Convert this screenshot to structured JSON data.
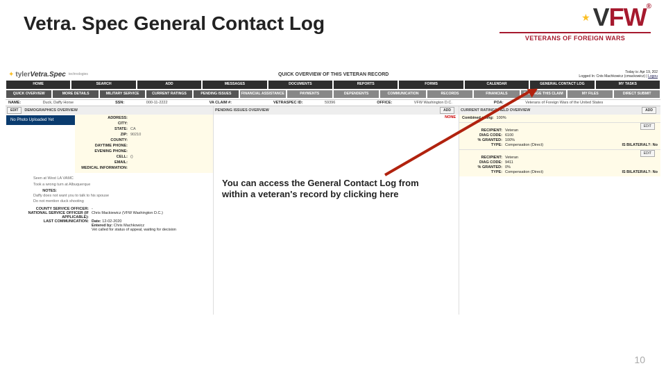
{
  "slide": {
    "title": "Vetra. Spec General Contact Log",
    "number": "10"
  },
  "vfw": {
    "sub": "VETERANS OF FOREIGN WARS",
    "reg": "®",
    "v": "V",
    "fw": "FW"
  },
  "callout": "You can access the General Contact Log from within a veteran's record by clicking here",
  "branding": {
    "t1": "tyler",
    "t2": "Vetra.Spec",
    "sub": "technologies"
  },
  "overview_title": "QUICK OVERVIEW OF THIS VETERAN RECORD",
  "login": {
    "today": "Today is: Apr 19, 202",
    "who": "Logged In: Cnts Machkowicz (cmackowicz) |",
    "logout": "Logou"
  },
  "menu1": [
    "HOME",
    "SEARCH",
    "ADD",
    "MESSAGES",
    "DOCUMENTS",
    "REPORTS",
    "FORMS",
    "CALENDAR",
    "GENERAL CONTACT LOG",
    "MY TASKS"
  ],
  "menu2": [
    "QUICK OVERVIEW",
    "MORE DETAILS",
    "MILITARY SERVICE",
    "CURRENT RATINGS",
    "PENDING ISSUES",
    "FINANCIAL ASSISTANCE",
    "PAYMENTS",
    "DEPENDENTS",
    "COMMUNICATION",
    "RECORDS",
    "FINANCIALS",
    "PACKAGE THIS CLAIM",
    "MY FILES",
    "DIRECT SUBMIT"
  ],
  "infobar": {
    "name_l": "NAME:",
    "name_v": "Duck, Daffy Horse",
    "ssn_l": "SSN:",
    "ssn_v": "000-11-2222",
    "vaclaim_l": "VA CLAIM #:",
    "vsid_l": "VETRASPEC ID:",
    "vsid_v": "59396",
    "office_l": "OFFICE:",
    "office_v": "VFW Washington D.C.",
    "poa_l": "POA:",
    "poa_v": "Veterans of Foreign Wars of the United States"
  },
  "col1": {
    "hdr": "DEMOGRAPHICS OVERVIEW",
    "edit": "EDIT",
    "photo": "No Photo Uploaded Yet",
    "rows": [
      {
        "l": "ADDRESS:",
        "v": ""
      },
      {
        "l": "CITY:",
        "v": ""
      },
      {
        "l": "STATE:",
        "v": "CA"
      },
      {
        "l": "ZIP:",
        "v": "90210"
      },
      {
        "l": "COUNTY:",
        "v": ""
      },
      {
        "l": "DAYTIME PHONE:",
        "v": ""
      },
      {
        "l": "EVENING PHONE:",
        "v": ""
      },
      {
        "l": "CELL:",
        "v": "()"
      },
      {
        "l": "EMAIL:",
        "v": ""
      },
      {
        "l": "MEDICAL INFORMATION:",
        "v": ""
      }
    ],
    "loc1": "Seen at West LA VAMC",
    "loc2": "Took a wrong turn at Albuquerque",
    "noteslab": "NOTES:",
    "note1": "Daffy does not want you to talk to his spouse",
    "note2": "Do not mention duck shooting",
    "cso_l": "COUNTY SERVICE OFFICER:",
    "cso_v": "-",
    "nso_l": "NATIONAL SERVICE OFFICER (IF APPLICABLE):",
    "nso_v": "Chris Mackiewicz (VFW Washington D.C.)",
    "last_l": "LAST COMMUNICATION:",
    "last_date_l": "Date:",
    "last_date_v": "12-02-2020",
    "ent_l": "Entered by:",
    "ent_v": "Chris Machkowicz",
    "last_note": "Vet called for status of appeal, waiting for decision"
  },
  "col2": {
    "hdr": "PENDING ISSUES OVERVIEW",
    "add": "ADD",
    "none": "NONE"
  },
  "col3": {
    "hdr": "CURRENT RATINGS HELD OVERVIEW",
    "add": "ADD",
    "combined_l": "Combined rating:",
    "combined_v": "100%",
    "items": [
      {
        "rcpt_l": "RECIPIENT:",
        "rcpt": "Veteran",
        "dc_l": "DIAG CODE:",
        "dc": "6100",
        "gr_l": "% GRANTED:",
        "gr": "100%",
        "ty_l": "TYPE:",
        "ty": "Compensation",
        "ef": "(Direct)",
        "bi_l": "IS BILATERAL?:",
        "bi": "No",
        "edit": "EDIT"
      },
      {
        "rcpt_l": "RECIPIENT:",
        "rcpt": "Veteran",
        "dc_l": "DIAG CODE:",
        "dc": "9411",
        "gr_l": "% GRANTED:",
        "gr": "0%",
        "ty_l": "TYPE:",
        "ty": "Compensation",
        "ef": "(Direct)",
        "bi_l": "IS BILATERAL?:",
        "bi": "No",
        "edit": "EDIT"
      }
    ]
  }
}
